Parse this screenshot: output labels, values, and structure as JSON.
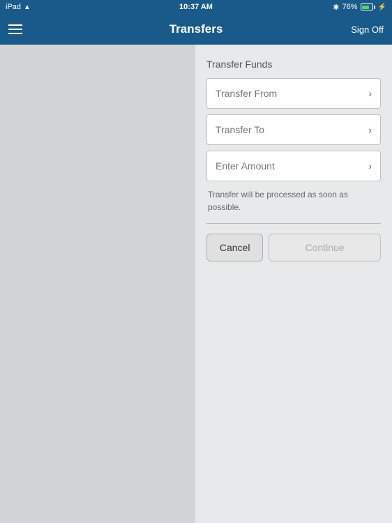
{
  "statusBar": {
    "carrier": "iPad",
    "time": "10:37 AM",
    "batteryPercent": "76%",
    "wifiSymbol": "▲"
  },
  "navBar": {
    "title": "Transfers",
    "signOffLabel": "Sign Off",
    "menuIcon": "menu"
  },
  "form": {
    "sectionTitle": "Transfer Funds",
    "transferFromLabel": "Transfer From",
    "transferToLabel": "Transfer To",
    "enterAmountLabel": "Enter Amount",
    "infoText": "Transfer will be processed as soon as possible.",
    "cancelLabel": "Cancel",
    "continueLabel": "Continue"
  }
}
